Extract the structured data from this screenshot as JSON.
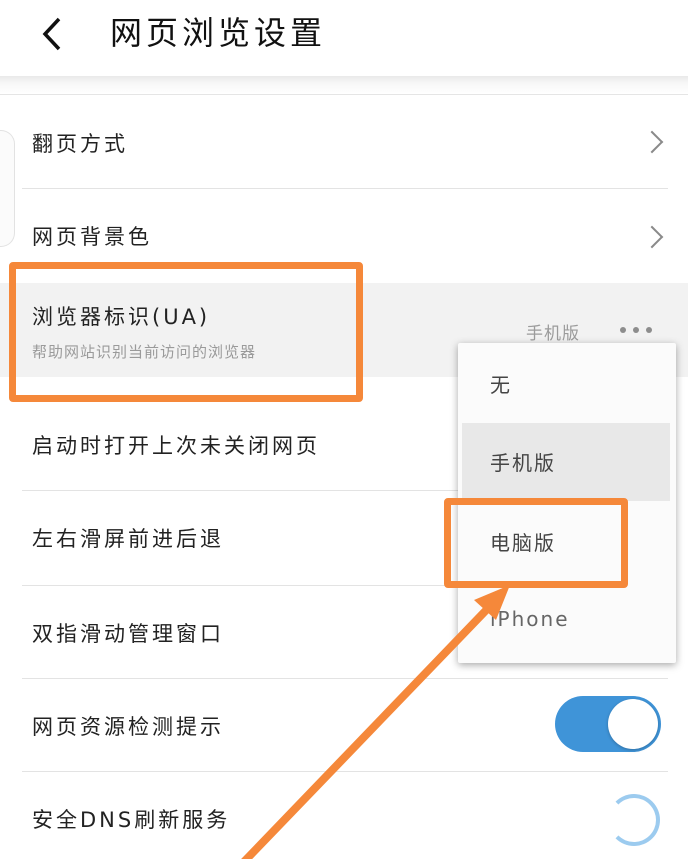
{
  "header": {
    "title": "网页浏览设置"
  },
  "settings": {
    "page_turn": "翻页方式",
    "bg_color": "网页背景色",
    "ua_title": "浏览器标识(UA)",
    "ua_subtitle": "帮助网站识别当前访问的浏览器",
    "ua_value": "手机版",
    "restore_pages": "启动时打开上次未关闭网页",
    "swipe_nav": "左右滑屏前进后退",
    "two_finger": "双指滑动管理窗口",
    "resource_detect": "网页资源检测提示",
    "secure_dns": "安全DNS刷新服务"
  },
  "toggles": {
    "resource_detect": true,
    "secure_dns": true
  },
  "dropdown": {
    "options": [
      "无",
      "手机版",
      "电脑版",
      "iPhone"
    ],
    "selected": "手机版"
  },
  "annotation": {
    "color": "#f5883a"
  },
  "colors": {
    "toggle_on": "#3f94d8"
  },
  "icons": [
    "back-arrow-icon",
    "chevron-right-icon",
    "more-dots-icon"
  ]
}
